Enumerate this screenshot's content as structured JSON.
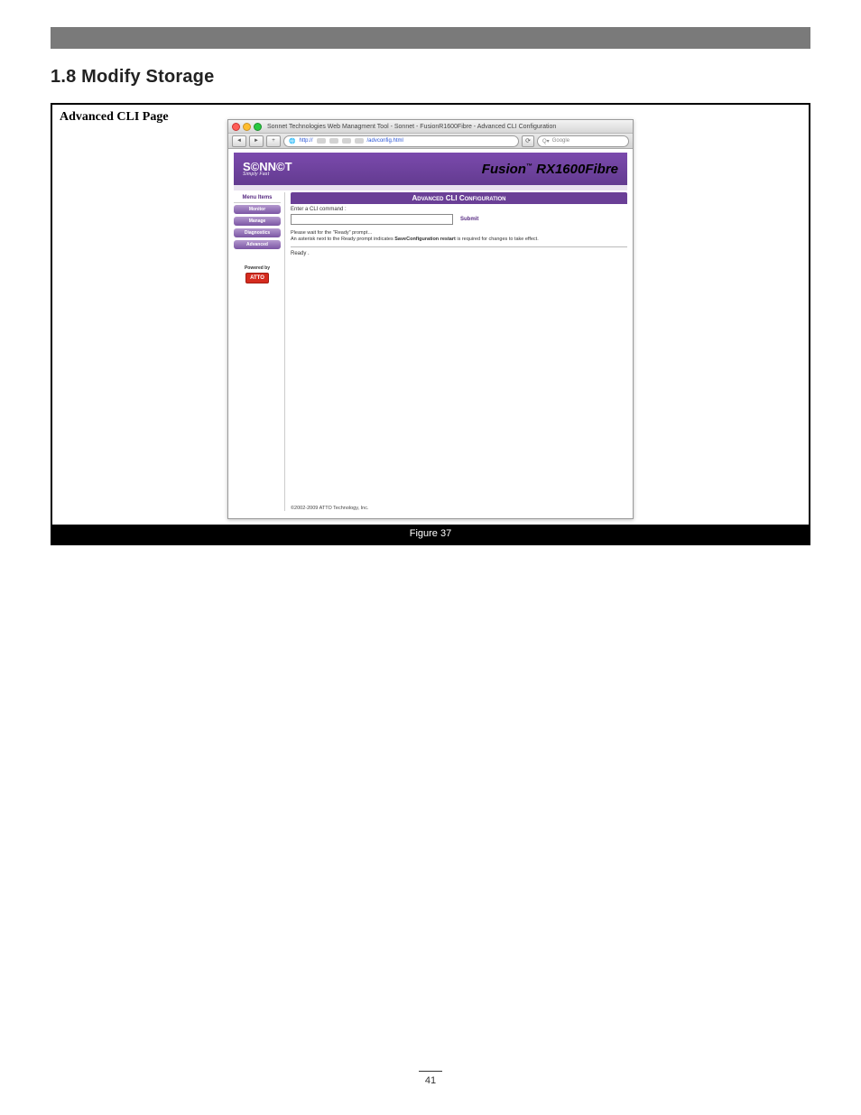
{
  "section_title": "1.8 Modify Storage",
  "figure_label": "Advanced CLI Page",
  "caption": "Figure 37",
  "page_number": "41",
  "browser": {
    "window_title": "Sonnet Technologies Web Managment Tool - Sonnet - FusionR1600Fibre - Advanced CLI Configuration",
    "url_prefix": "http://",
    "url_suffix": "/advconfig.html",
    "search_placeholder": "Google",
    "icons": {
      "back": "◄",
      "forward": "►",
      "add": "+",
      "reload": "⟳",
      "magnifier": "Q▾",
      "globe": "🌐"
    }
  },
  "brand": {
    "logo_text": "S©NN©T",
    "slogan": "Simply Fast",
    "product": "Fusion",
    "tm": "™",
    "model": " RX1600Fibre"
  },
  "sidebar": {
    "heading": "Menu Items",
    "items": [
      "Monitor",
      "Manage",
      "Diagnostics",
      "Advanced"
    ],
    "powered_by": "Powered by",
    "badge": "ATTO"
  },
  "panel": {
    "title": "Advanced CLI Configuration",
    "cmd_label": "Enter a CLI command :",
    "submit": "Submit",
    "help_line1": "Please wait for the \"Ready\" prompt…",
    "help_line2_pre": "An asterisk next to the Ready prompt indicates ",
    "help_line2_bold": "SaveConfiguration restart",
    "help_line2_post": " is required for changes to take effect.",
    "ready": "Ready .",
    "copyright": "©2002-2009 ATTO Technology, Inc."
  }
}
